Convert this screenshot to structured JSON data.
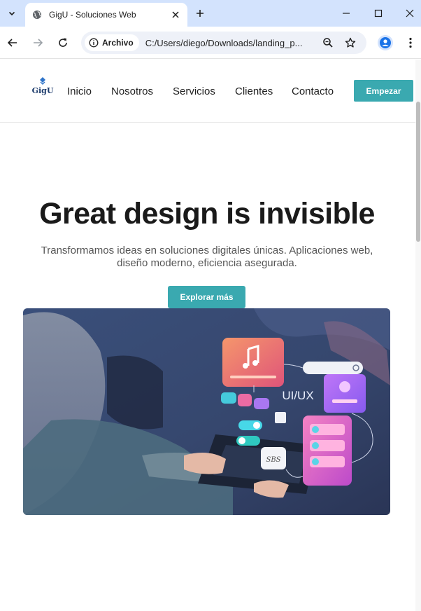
{
  "browser": {
    "tab": {
      "title": "GigU - Soluciones Web"
    },
    "address": {
      "security_chip": "Archivo",
      "url": "C:/Users/diego/Downloads/landing_p..."
    },
    "icons": {
      "tab_search": "chevron-down-icon",
      "favicon": "globe-icon",
      "close_tab": "close-icon",
      "new_tab": "plus-icon",
      "minimize": "minimize-icon",
      "maximize": "maximize-icon",
      "close_window": "close-icon",
      "back": "arrow-left-icon",
      "forward": "arrow-right-icon",
      "reload": "reload-icon",
      "info": "info-icon",
      "zoom": "zoom-icon",
      "bookmark": "star-icon",
      "profile": "person-icon",
      "menu": "more-vert-icon"
    }
  },
  "site": {
    "logo": {
      "text": "GigU"
    },
    "nav": [
      {
        "label": "Inicio"
      },
      {
        "label": "Nosotros"
      },
      {
        "label": "Servicios"
      },
      {
        "label": "Clientes"
      },
      {
        "label": "Contacto"
      }
    ],
    "cta": "Empezar",
    "hero": {
      "title": "Great design is invisible",
      "subtitle": "Transformamos ideas en soluciones digitales únicas. Aplicaciones web, diseño moderno, eficiencia asegurada.",
      "button": "Explorar más",
      "image_text": {
        "uiux": "UI/UX",
        "sbs": "SBS"
      }
    }
  },
  "colors": {
    "accent": "#3aa9b0",
    "tabstrip": "#d3e3fd",
    "omnibox": "#eef1f8",
    "text": "#1f1f1f"
  }
}
